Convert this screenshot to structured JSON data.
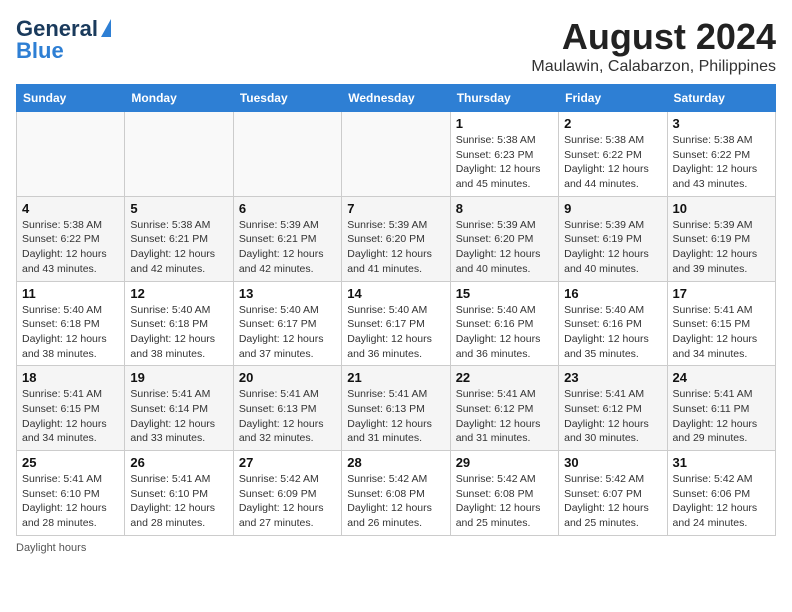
{
  "header": {
    "logo_line1": "General",
    "logo_line2": "Blue",
    "month": "August 2024",
    "location": "Maulawin, Calabarzon, Philippines"
  },
  "weekdays": [
    "Sunday",
    "Monday",
    "Tuesday",
    "Wednesday",
    "Thursday",
    "Friday",
    "Saturday"
  ],
  "weeks": [
    [
      {
        "day": "",
        "info": ""
      },
      {
        "day": "",
        "info": ""
      },
      {
        "day": "",
        "info": ""
      },
      {
        "day": "",
        "info": ""
      },
      {
        "day": "1",
        "info": "Sunrise: 5:38 AM\nSunset: 6:23 PM\nDaylight: 12 hours\nand 45 minutes."
      },
      {
        "day": "2",
        "info": "Sunrise: 5:38 AM\nSunset: 6:22 PM\nDaylight: 12 hours\nand 44 minutes."
      },
      {
        "day": "3",
        "info": "Sunrise: 5:38 AM\nSunset: 6:22 PM\nDaylight: 12 hours\nand 43 minutes."
      }
    ],
    [
      {
        "day": "4",
        "info": "Sunrise: 5:38 AM\nSunset: 6:22 PM\nDaylight: 12 hours\nand 43 minutes."
      },
      {
        "day": "5",
        "info": "Sunrise: 5:38 AM\nSunset: 6:21 PM\nDaylight: 12 hours\nand 42 minutes."
      },
      {
        "day": "6",
        "info": "Sunrise: 5:39 AM\nSunset: 6:21 PM\nDaylight: 12 hours\nand 42 minutes."
      },
      {
        "day": "7",
        "info": "Sunrise: 5:39 AM\nSunset: 6:20 PM\nDaylight: 12 hours\nand 41 minutes."
      },
      {
        "day": "8",
        "info": "Sunrise: 5:39 AM\nSunset: 6:20 PM\nDaylight: 12 hours\nand 40 minutes."
      },
      {
        "day": "9",
        "info": "Sunrise: 5:39 AM\nSunset: 6:19 PM\nDaylight: 12 hours\nand 40 minutes."
      },
      {
        "day": "10",
        "info": "Sunrise: 5:39 AM\nSunset: 6:19 PM\nDaylight: 12 hours\nand 39 minutes."
      }
    ],
    [
      {
        "day": "11",
        "info": "Sunrise: 5:40 AM\nSunset: 6:18 PM\nDaylight: 12 hours\nand 38 minutes."
      },
      {
        "day": "12",
        "info": "Sunrise: 5:40 AM\nSunset: 6:18 PM\nDaylight: 12 hours\nand 38 minutes."
      },
      {
        "day": "13",
        "info": "Sunrise: 5:40 AM\nSunset: 6:17 PM\nDaylight: 12 hours\nand 37 minutes."
      },
      {
        "day": "14",
        "info": "Sunrise: 5:40 AM\nSunset: 6:17 PM\nDaylight: 12 hours\nand 36 minutes."
      },
      {
        "day": "15",
        "info": "Sunrise: 5:40 AM\nSunset: 6:16 PM\nDaylight: 12 hours\nand 36 minutes."
      },
      {
        "day": "16",
        "info": "Sunrise: 5:40 AM\nSunset: 6:16 PM\nDaylight: 12 hours\nand 35 minutes."
      },
      {
        "day": "17",
        "info": "Sunrise: 5:41 AM\nSunset: 6:15 PM\nDaylight: 12 hours\nand 34 minutes."
      }
    ],
    [
      {
        "day": "18",
        "info": "Sunrise: 5:41 AM\nSunset: 6:15 PM\nDaylight: 12 hours\nand 34 minutes."
      },
      {
        "day": "19",
        "info": "Sunrise: 5:41 AM\nSunset: 6:14 PM\nDaylight: 12 hours\nand 33 minutes."
      },
      {
        "day": "20",
        "info": "Sunrise: 5:41 AM\nSunset: 6:13 PM\nDaylight: 12 hours\nand 32 minutes."
      },
      {
        "day": "21",
        "info": "Sunrise: 5:41 AM\nSunset: 6:13 PM\nDaylight: 12 hours\nand 31 minutes."
      },
      {
        "day": "22",
        "info": "Sunrise: 5:41 AM\nSunset: 6:12 PM\nDaylight: 12 hours\nand 31 minutes."
      },
      {
        "day": "23",
        "info": "Sunrise: 5:41 AM\nSunset: 6:12 PM\nDaylight: 12 hours\nand 30 minutes."
      },
      {
        "day": "24",
        "info": "Sunrise: 5:41 AM\nSunset: 6:11 PM\nDaylight: 12 hours\nand 29 minutes."
      }
    ],
    [
      {
        "day": "25",
        "info": "Sunrise: 5:41 AM\nSunset: 6:10 PM\nDaylight: 12 hours\nand 28 minutes."
      },
      {
        "day": "26",
        "info": "Sunrise: 5:41 AM\nSunset: 6:10 PM\nDaylight: 12 hours\nand 28 minutes."
      },
      {
        "day": "27",
        "info": "Sunrise: 5:42 AM\nSunset: 6:09 PM\nDaylight: 12 hours\nand 27 minutes."
      },
      {
        "day": "28",
        "info": "Sunrise: 5:42 AM\nSunset: 6:08 PM\nDaylight: 12 hours\nand 26 minutes."
      },
      {
        "day": "29",
        "info": "Sunrise: 5:42 AM\nSunset: 6:08 PM\nDaylight: 12 hours\nand 25 minutes."
      },
      {
        "day": "30",
        "info": "Sunrise: 5:42 AM\nSunset: 6:07 PM\nDaylight: 12 hours\nand 25 minutes."
      },
      {
        "day": "31",
        "info": "Sunrise: 5:42 AM\nSunset: 6:06 PM\nDaylight: 12 hours\nand 24 minutes."
      }
    ]
  ],
  "footer": "Daylight hours"
}
